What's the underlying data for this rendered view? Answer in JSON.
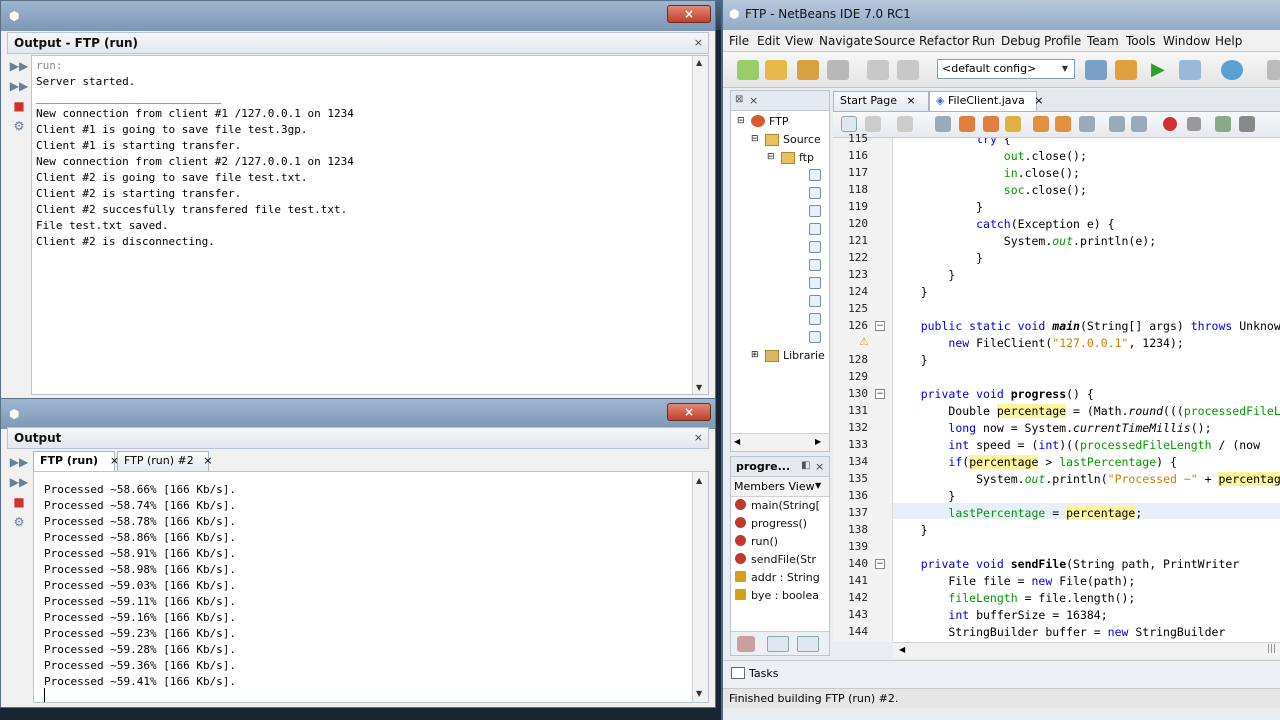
{
  "output_window_1": {
    "title": "Output - FTP (run)",
    "lines": [
      "run:",
      "Server started.",
      "____________________________",
      "New connection from client #1 /127.0.0.1 on 1234",
      "Client #1 is going to save file test.3gp.",
      "Client #1 is starting transfer.",
      "New connection from client #2 /127.0.0.1 on 1234",
      "Client #2 is going to save file test.txt.",
      "Client #2 is starting transfer.",
      "Client #2 succesfully transfered file test.txt.",
      "File test.txt saved.",
      "Client #2 is disconnecting."
    ]
  },
  "output_window_2": {
    "title": "Output",
    "tabs": [
      {
        "label": "FTP (run)",
        "active": true
      },
      {
        "label": "FTP (run) #2",
        "active": false
      }
    ],
    "lines": [
      "Processed ~58.66% [166 Kb/s].",
      "Processed ~58.74% [166 Kb/s].",
      "Processed ~58.78% [166 Kb/s].",
      "Processed ~58.86% [166 Kb/s].",
      "Processed ~58.91% [166 Kb/s].",
      "Processed ~58.98% [166 Kb/s].",
      "Processed ~59.03% [166 Kb/s].",
      "Processed ~59.11% [166 Kb/s].",
      "Processed ~59.16% [166 Kb/s].",
      "Processed ~59.23% [166 Kb/s].",
      "Processed ~59.28% [166 Kb/s].",
      "Processed ~59.36% [166 Kb/s].",
      "Processed ~59.41% [166 Kb/s]."
    ]
  },
  "close_glyph": "×",
  "netbeans": {
    "title": "FTP - NetBeans IDE 7.0 RC1",
    "menus": [
      "File",
      "Edit",
      "View",
      "Navigate",
      "Source",
      "Refactor",
      "Run",
      "Debug",
      "Profile",
      "Team",
      "Tools",
      "Window",
      "Help"
    ],
    "config": "<default config>",
    "project": {
      "root": "FTP",
      "source": "Source",
      "package": "ftp",
      "libraries": "Librarie"
    },
    "navigator": {
      "title": "progre...",
      "view": "Members View",
      "members": [
        {
          "name": "main(String[",
          "icon_color": "#c0392b"
        },
        {
          "name": "progress()",
          "icon_color": "#c0392b"
        },
        {
          "name": "run()",
          "icon_color": "#c0392b"
        },
        {
          "name": "sendFile(Str",
          "icon_color": "#c0392b"
        },
        {
          "name": "addr : String",
          "icon_color": "#d4a017"
        },
        {
          "name": "bye : boolea",
          "icon_color": "#d4a017"
        }
      ]
    },
    "editor_tabs": [
      {
        "label": "Start Page",
        "active": false
      },
      {
        "label": "FileClient.java",
        "active": true
      }
    ],
    "line_numbers": [
      "115",
      "116",
      "117",
      "118",
      "119",
      "120",
      "121",
      "122",
      "123",
      "124",
      "125",
      "126",
      "",
      "128",
      "129",
      "130",
      "131",
      "132",
      "133",
      "134",
      "135",
      "136",
      "137",
      "138",
      "139",
      "140",
      "141",
      "142",
      "143",
      "144"
    ],
    "tasks_label": "Tasks",
    "status": "Finished building FTP (run) #2."
  }
}
